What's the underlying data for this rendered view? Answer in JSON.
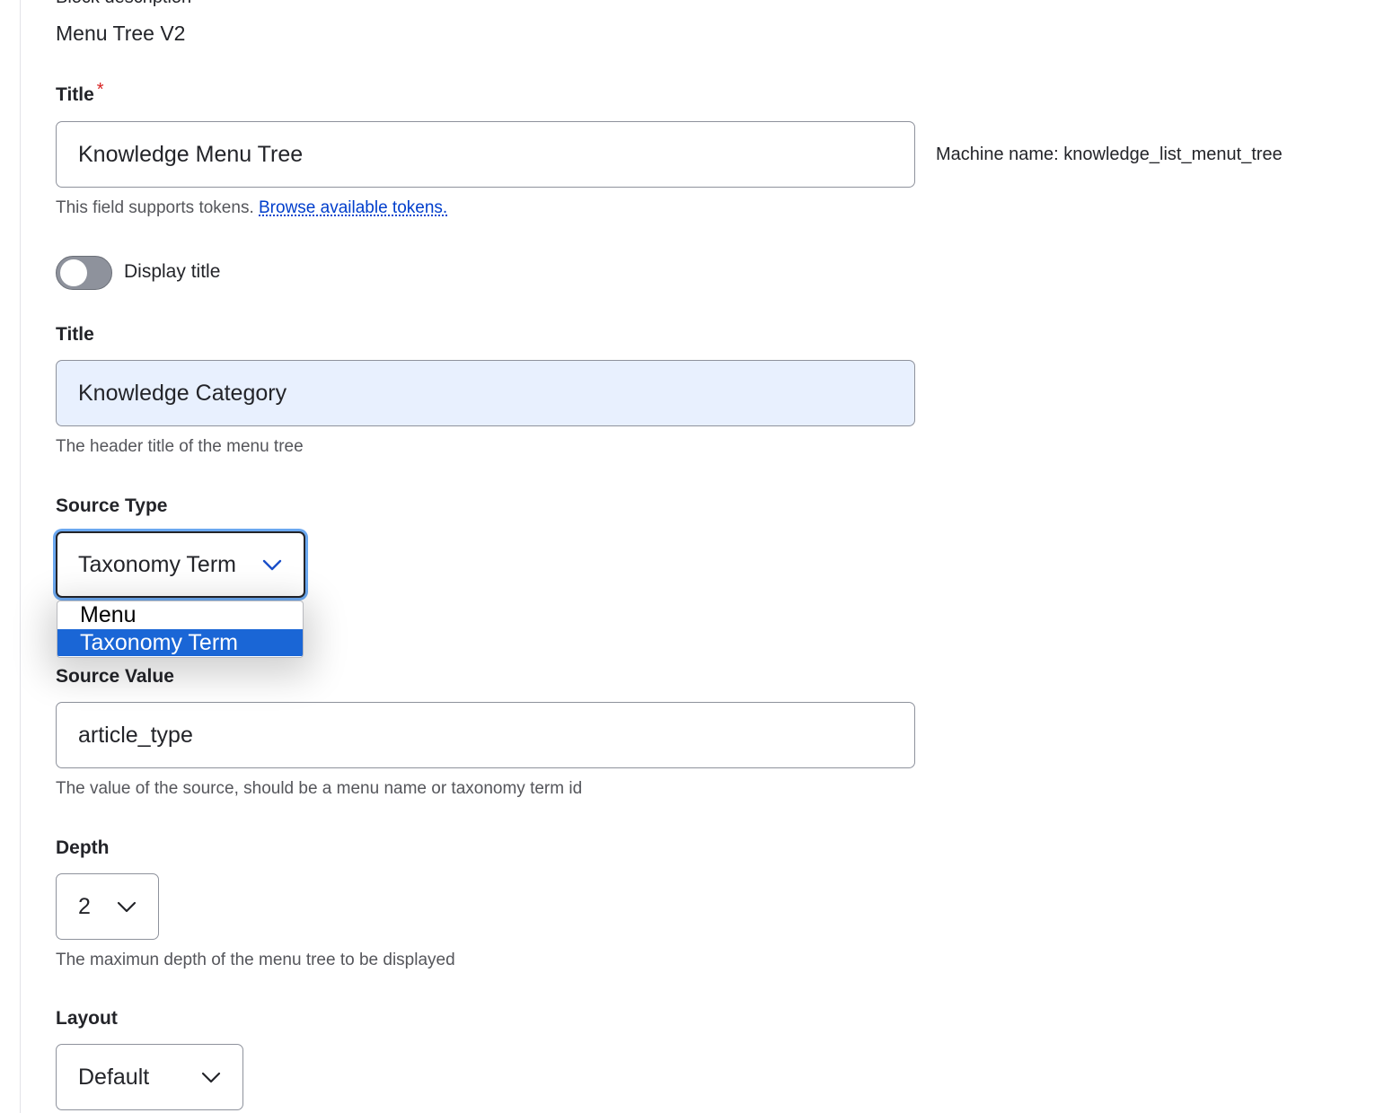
{
  "block": {
    "cutoff_label": "Block description",
    "name": "Menu Tree V2"
  },
  "title_field": {
    "label": "Title",
    "required_marker": "*",
    "value": "Knowledge Menu Tree",
    "machine_name": "Machine name: knowledge_list_menut_tree",
    "help_prefix": "This field supports tokens.",
    "help_link": "Browse available tokens."
  },
  "display_title": {
    "label": "Display title",
    "checked": false
  },
  "header_title": {
    "label": "Title",
    "value": "Knowledge Category",
    "help": "The header title of the menu tree"
  },
  "source_type": {
    "label": "Source Type",
    "selected": "Taxonomy Term",
    "options": [
      "Menu",
      "Taxonomy Term"
    ]
  },
  "source_value": {
    "label": "Source Value",
    "value": "article_type",
    "help": "The value of the source, should be a menu name or taxonomy term id"
  },
  "depth": {
    "label": "Depth",
    "selected": "2",
    "help": "The maximun depth of the menu tree to be displayed"
  },
  "layout": {
    "label": "Layout",
    "selected": "Default"
  },
  "icons": {
    "select_arrow": "chevron-down-icon"
  },
  "colors": {
    "focus_ring": "#6ba8f0",
    "selected_option": "#1a66d6",
    "link": "#003ecc",
    "required": "#d72222",
    "autofill_bg": "#e8f0fe"
  }
}
